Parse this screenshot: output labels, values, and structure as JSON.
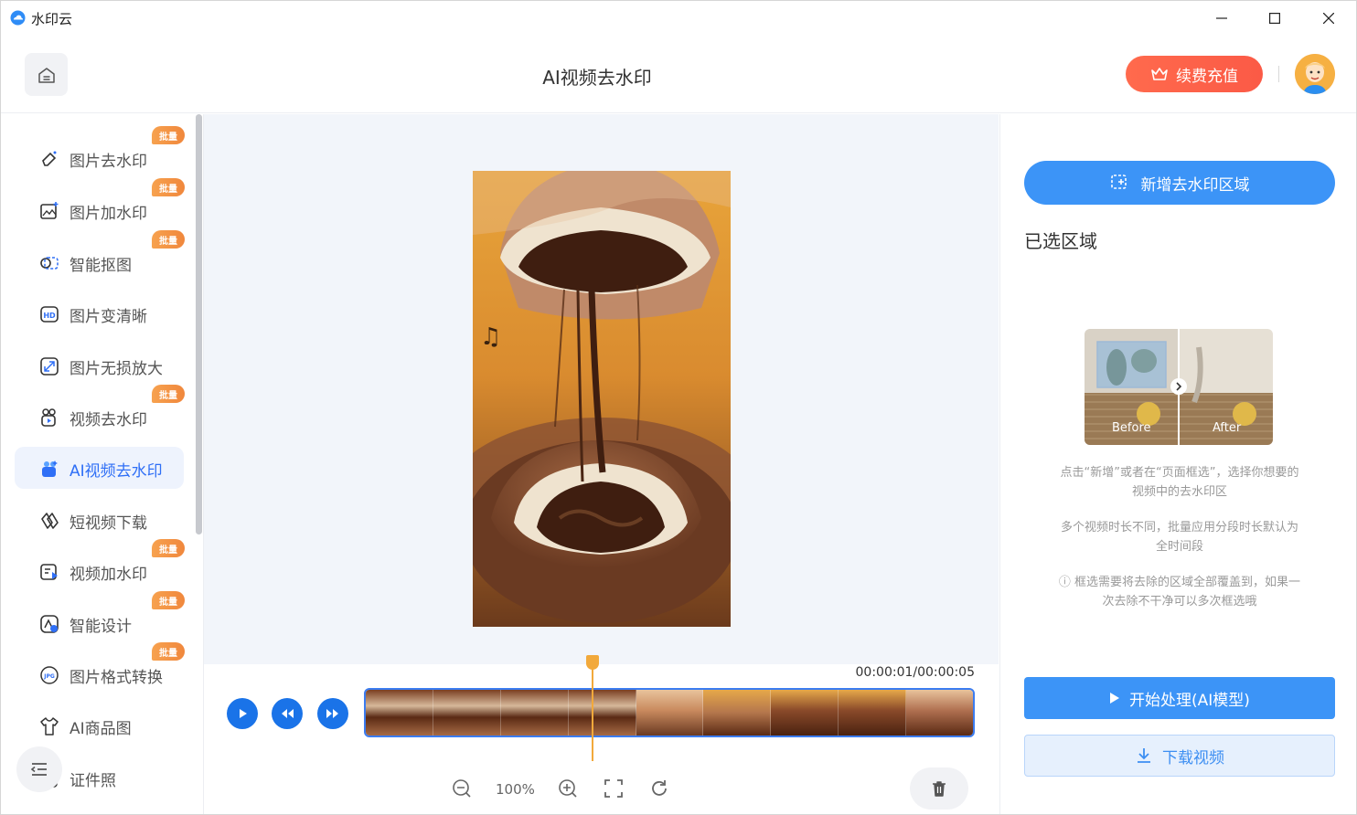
{
  "app": {
    "name": "水印云"
  },
  "header": {
    "title": "AI视频去水印",
    "vip_label": "续费充值"
  },
  "sidebar": {
    "items": [
      {
        "label": "图片去水印",
        "icon": "eraser-icon",
        "badge": "批量"
      },
      {
        "label": "图片加水印",
        "icon": "image-add-icon",
        "badge": "批量"
      },
      {
        "label": "智能抠图",
        "icon": "cutout-icon",
        "badge": "批量"
      },
      {
        "label": "图片变清晰",
        "icon": "hd-icon",
        "badge": ""
      },
      {
        "label": "图片无损放大",
        "icon": "enlarge-icon",
        "badge": ""
      },
      {
        "label": "视频去水印",
        "icon": "video-clean-icon",
        "badge": "批量"
      },
      {
        "label": "AI视频去水印",
        "icon": "ai-video-icon",
        "badge": ""
      },
      {
        "label": "短视频下载",
        "icon": "link-download-icon",
        "badge": ""
      },
      {
        "label": "视频加水印",
        "icon": "video-add-icon",
        "badge": "批量"
      },
      {
        "label": "智能设计",
        "icon": "design-icon",
        "badge": "批量"
      },
      {
        "label": "图片格式转换",
        "icon": "jpg-convert-icon",
        "badge": "批量"
      },
      {
        "label": "AI商品图",
        "icon": "tshirt-icon",
        "badge": ""
      },
      {
        "label": "证件照",
        "icon": "id-photo-icon",
        "badge": ""
      }
    ],
    "active_index": 6
  },
  "timeline": {
    "time": "00:00:01/00:00:05",
    "zoom": "100%",
    "playhead_fraction": 0.2
  },
  "right_panel": {
    "add_region_label": "新增去水印区域",
    "selected_title": "已选区域",
    "before_label": "Before",
    "after_label": "After",
    "tip1": "点击“新增”或者在“页面框选”，选择你想要的视频中的去水印区",
    "tip2": "多个视频时长不同，批量应用分段时长默认为全时间段",
    "tip3": "ⓘ 框选需要将去除的区域全部覆盖到，如果一次去除不干净可以多次框选哦",
    "start_label": "开始处理(AI模型)",
    "download_label": "下载视频"
  },
  "colors": {
    "primary": "#3c94f7",
    "accent": "#fb5a46",
    "badge": "#f0873c",
    "playhead": "#f2a93b"
  }
}
